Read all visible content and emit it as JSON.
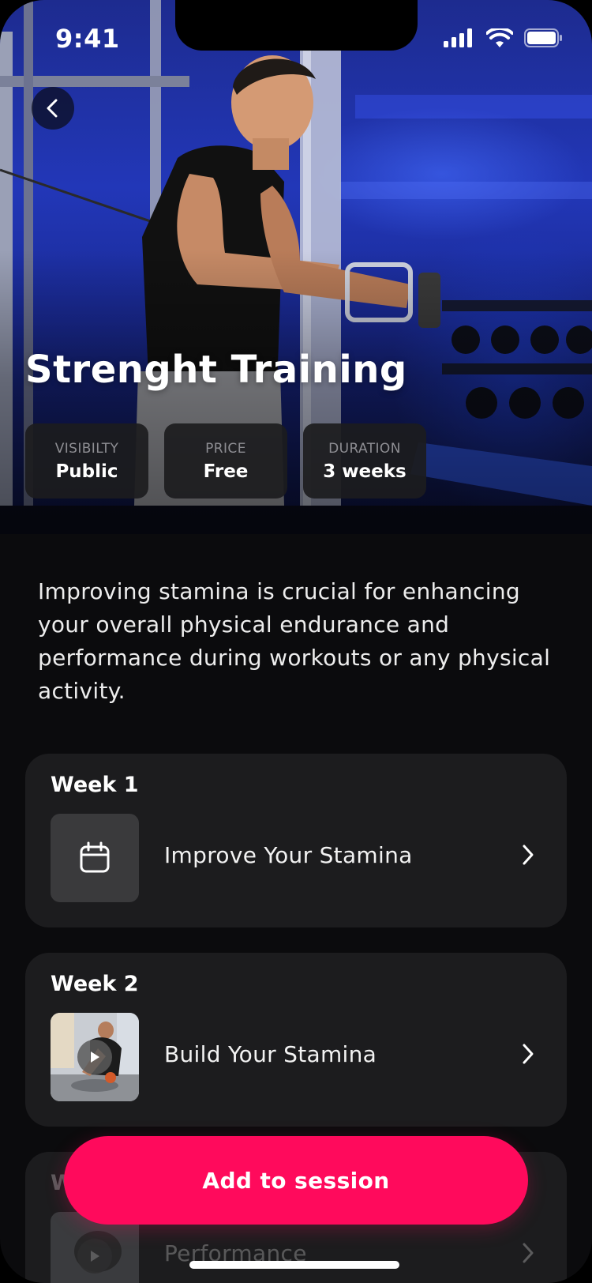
{
  "status_bar": {
    "time": "9:41"
  },
  "hero": {
    "title": "Strenght Training"
  },
  "stats": [
    {
      "label": "VISIBILTY",
      "value": "Public"
    },
    {
      "label": "PRICE",
      "value": "Free"
    },
    {
      "label": "DURATION",
      "value": "3 weeks"
    }
  ],
  "description": "Improving stamina is crucial for enhancing your overall physical endurance and performance during workouts or any physical activity.",
  "weeks": [
    {
      "title": "Week 1",
      "session": "Improve Your Stamina",
      "thumb": "calendar-icon"
    },
    {
      "title": "Week 2",
      "session": "Build Your Stamina",
      "thumb": "video-thumbnail"
    },
    {
      "title": "W",
      "session": "Performance",
      "thumb": "video-thumbnail"
    }
  ],
  "cta": {
    "label": "Add to session"
  },
  "colors": {
    "accent": "#ff0a5c",
    "card": "#1c1c1e",
    "background": "#0b0b0d"
  }
}
